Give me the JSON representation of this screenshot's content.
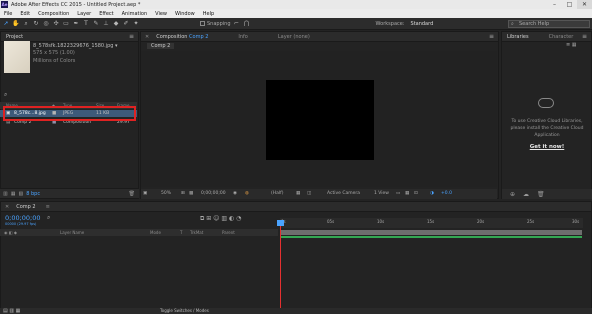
{
  "window": {
    "app_icon": "Ae",
    "title": "Adobe After Effects CC 2015 - Untitled Project.aep *",
    "minimize": "–",
    "maximize": "□",
    "close": "✕"
  },
  "menu": [
    "File",
    "Edit",
    "Composition",
    "Layer",
    "Effect",
    "Animation",
    "View",
    "Window",
    "Help"
  ],
  "toolbar": {
    "snapping_label": "Snapping",
    "workspace_label": "Workspace:",
    "workspace_value": "Standard",
    "search_placeholder": "Search Help"
  },
  "project": {
    "tab": "Project",
    "selected_name": "8_578sfk.1822329676_1580.jpg ▾",
    "selected_dims": "575 x 575 (1.00)",
    "selected_colors": "Millions of Colors",
    "columns": [
      "Name",
      "Type",
      "Size",
      "Frame"
    ],
    "items": [
      {
        "name": "8_578c...8.jpg",
        "type": "JPEG",
        "size": "11 KB",
        "frame": ""
      },
      {
        "name": "Comp 2",
        "type": "Composition",
        "size": "",
        "frame": "29.97"
      }
    ],
    "bpc": "8 bpc"
  },
  "composition": {
    "tab": "Composition",
    "tab_comp": "Comp 2",
    "tab_info": "Info",
    "tab_layer": "Layer (none)",
    "sub_tab": "Comp 2",
    "zoom": "50%",
    "timecode": "0;00;00;00",
    "resolution": "(Half)",
    "camera": "Active Camera",
    "views": "1 View",
    "exposure": "+0.0"
  },
  "libraries": {
    "tab": "Libraries",
    "tab_character": "Character",
    "message": "To use Creative Cloud Libraries, please install the Creative Cloud Application",
    "link": "Get it now!"
  },
  "timeline": {
    "tab": "Comp 2",
    "timecode": "0;00;00;00",
    "frames": "00000 (29.97 fps)",
    "columns": {
      "name": "Layer Name",
      "mode": "Mode",
      "t": "T",
      "trkmat": "TrkMat",
      "parent": "Parent"
    },
    "ruler": [
      "0s",
      "05s",
      "10s",
      "15s",
      "20s",
      "25s",
      "30s"
    ],
    "footer": "Toggle Switches / Modes"
  }
}
